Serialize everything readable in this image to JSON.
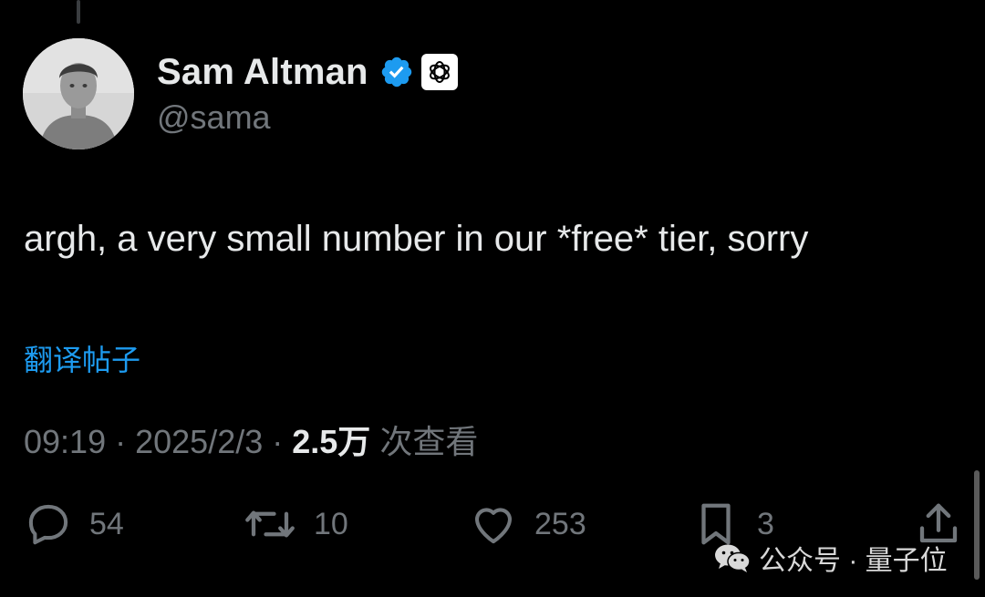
{
  "author": {
    "display_name": "Sam Altman",
    "handle": "@sama",
    "verified": true,
    "avatar": "avatar-photo",
    "affiliation_badge": "openai-logo-icon"
  },
  "tweet": {
    "text": "argh, a very small number in our *free* tier, sorry",
    "translate_label": "翻译帖子"
  },
  "meta": {
    "time": "09:19",
    "separator": "·",
    "date": "2025/2/3",
    "views_count": "2.5万",
    "views_label": "次查看"
  },
  "actions": {
    "reply": {
      "icon": "reply-icon",
      "count": "54"
    },
    "retweet": {
      "icon": "retweet-icon",
      "count": "10"
    },
    "like": {
      "icon": "heart-icon",
      "count": "253"
    },
    "bookmark": {
      "icon": "bookmark-icon",
      "count": "3"
    },
    "share": {
      "icon": "share-icon"
    }
  },
  "watermark": {
    "text": "公众号 · 量子位",
    "icon": "wechat-icon"
  },
  "colors": {
    "background": "#000000",
    "primary_text": "#e7e9ea",
    "secondary_text": "#71767b",
    "link": "#1d9bf0",
    "verified": "#1d9bf0"
  }
}
